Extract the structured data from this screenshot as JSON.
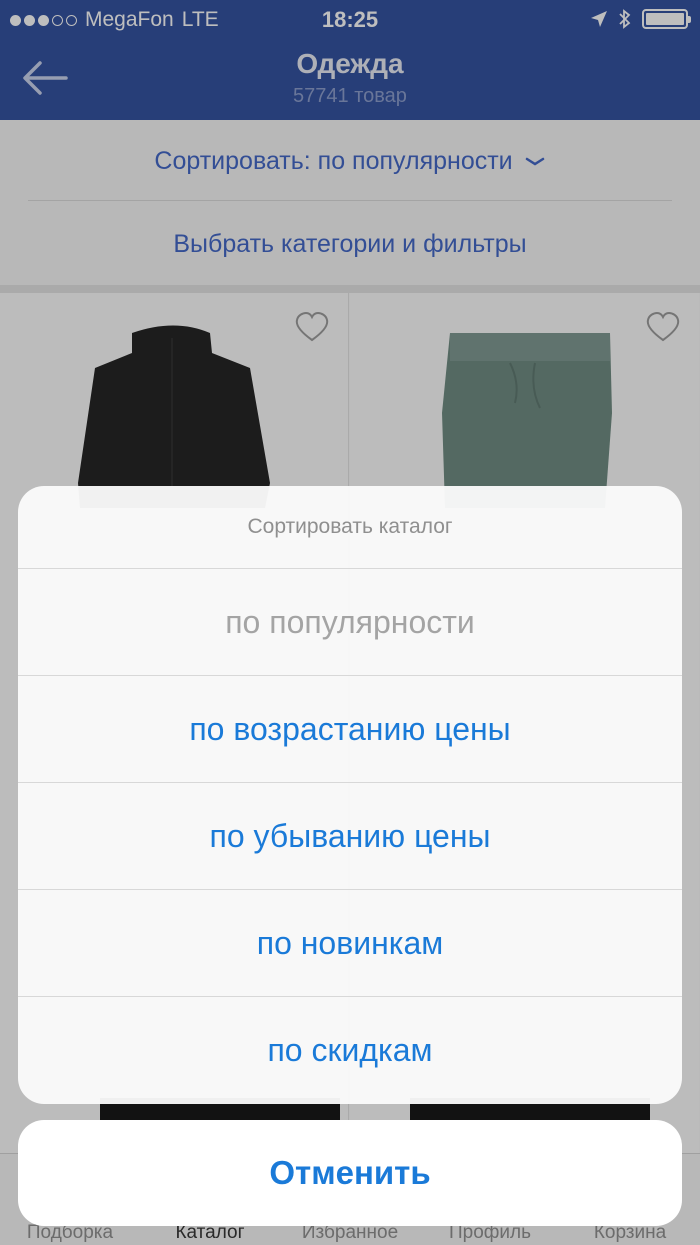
{
  "status_bar": {
    "carrier": "MegaFon",
    "network": "LTE",
    "time": "18:25",
    "signal_bars_filled": 3,
    "signal_bars_total": 5
  },
  "nav": {
    "title": "Одежда",
    "subtitle": "57741 товар"
  },
  "filters": {
    "sort_label": "Сортировать: по популярности",
    "filter_label": "Выбрать категории и фильтры"
  },
  "tabbar": {
    "items": [
      "Подборка",
      "Каталог",
      "Избранное",
      "Профиль",
      "Корзина"
    ]
  },
  "action_sheet": {
    "title": "Сортировать каталог",
    "options": [
      {
        "label": "по популярности",
        "selected": true
      },
      {
        "label": "по возрастанию цены",
        "selected": false
      },
      {
        "label": "по убыванию цены",
        "selected": false
      },
      {
        "label": "по новинкам",
        "selected": false
      },
      {
        "label": "по скидкам",
        "selected": false
      }
    ],
    "cancel": "Отменить"
  },
  "colors": {
    "nav_blue": "#2f4e9f",
    "link_blue": "#3f65c7",
    "action_blue": "#1a7ad8"
  }
}
